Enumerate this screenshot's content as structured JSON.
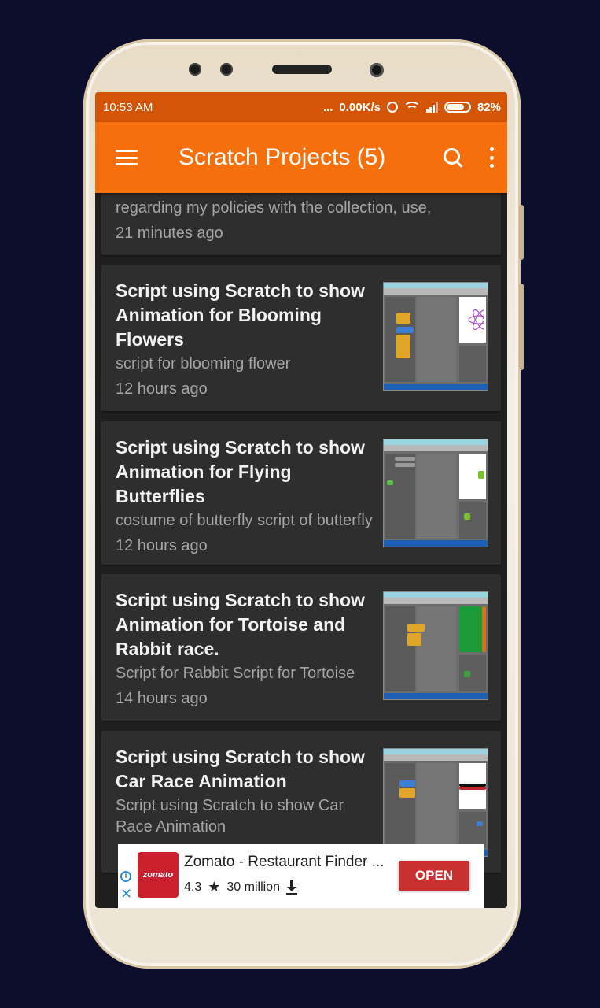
{
  "status_bar": {
    "time": "10:53 AM",
    "dots": "...",
    "speed": "0.00K/s",
    "battery": "82%"
  },
  "app_bar": {
    "title": "Scratch Projects (5)",
    "menu_icon": "hamburger-menu-icon",
    "search_icon": "search-icon",
    "more_icon": "more-vert-icon"
  },
  "partial_card": {
    "desc": "regarding my policies with the collection, use,",
    "time": "21 minutes ago"
  },
  "projects": [
    {
      "title": "Script using Scratch to show Animation for Blooming Flowers",
      "desc": "script for blooming flower",
      "time": "12 hours ago"
    },
    {
      "title": "Script using Scratch to show Animation for Flying Butterflies",
      "desc": "costume of butterfly script of butterfly",
      "time": "12 hours ago"
    },
    {
      "title": "Script using Scratch to show Animation for Tortoise and Rabbit race.",
      "desc": "Script for Rabbit  Script for Tortoise",
      "time": "14 hours ago"
    },
    {
      "title": "Script using Scratch to show Car Race Animation",
      "desc": "Script using Scratch to show Car Race Animation",
      "time": ""
    }
  ],
  "ad": {
    "logo_text": "zomato",
    "app_name": "Zomato - Restaurant Finder ...",
    "rating": "4.3",
    "installs": "30 million",
    "button": "OPEN",
    "colors": {
      "brand": "#cb202d",
      "button": "#c82f2f"
    }
  },
  "colors": {
    "status_bar": "#d45508",
    "app_bar": "#f5700c",
    "background": "#1f1f1f",
    "card": "#2e2e2e"
  }
}
